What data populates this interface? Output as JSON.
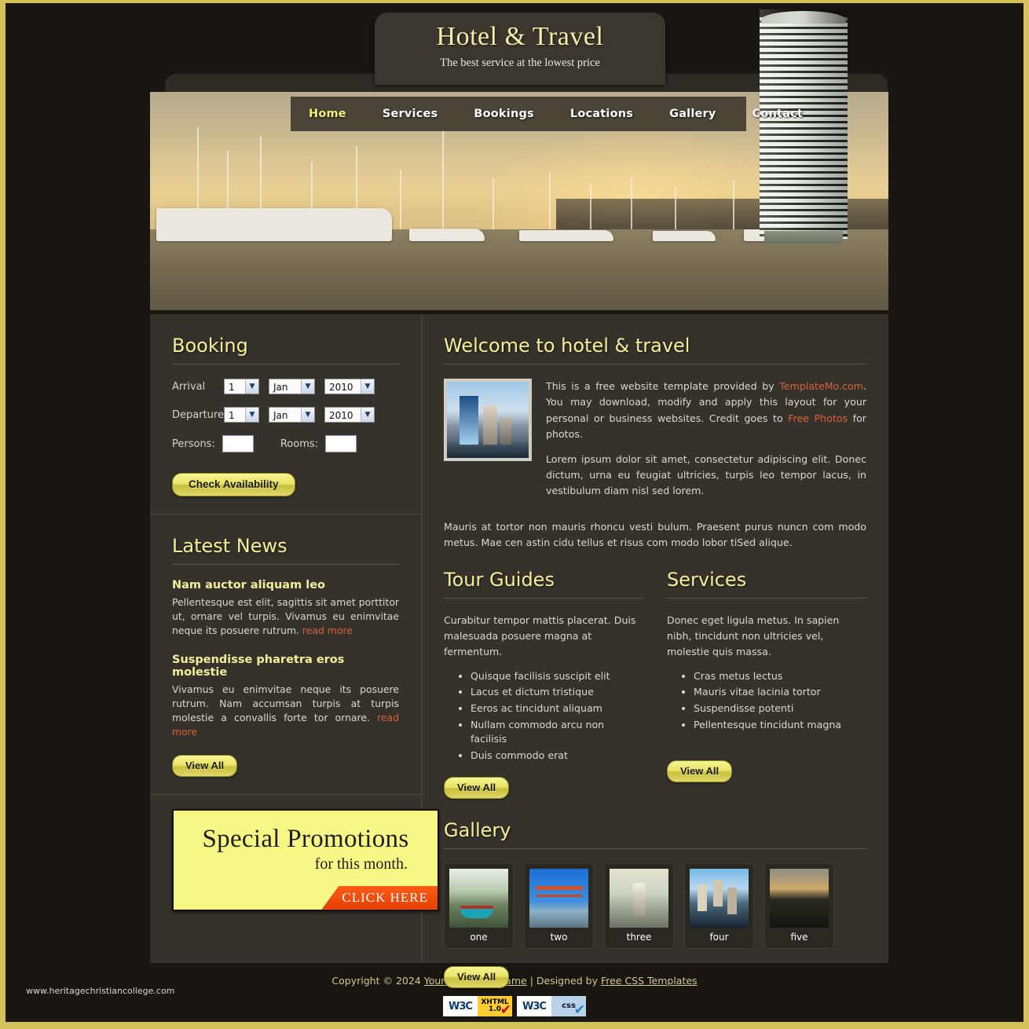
{
  "site": {
    "title": "Hotel & Travel",
    "slogan": "The best service at the lowest price"
  },
  "nav": {
    "items": [
      {
        "label": "Home",
        "active": true
      },
      {
        "label": "Services",
        "active": false
      },
      {
        "label": "Bookings",
        "active": false
      },
      {
        "label": "Locations",
        "active": false
      },
      {
        "label": "Gallery",
        "active": false
      },
      {
        "label": "Contact",
        "active": false
      }
    ]
  },
  "booking": {
    "heading": "Booking",
    "arrival_label": "Arrival",
    "departure_label": "Departure",
    "persons_label": "Persons:",
    "rooms_label": "Rooms:",
    "arrival": {
      "day": "1",
      "month": "Jan",
      "year": "2010"
    },
    "departure": {
      "day": "1",
      "month": "Jan",
      "year": "2010"
    },
    "persons_value": "",
    "rooms_value": "",
    "submit_label": "Check Availability"
  },
  "news": {
    "heading": "Latest News",
    "items": [
      {
        "title": "Nam auctor aliquam leo",
        "text": "Pellentesque est elit, sagittis sit amet porttitor ut, ornare vel turpis. Vivamus eu enimvitae neque its posuere rutrum. ",
        "readmore": "read more"
      },
      {
        "title": "Suspendisse pharetra eros molestie",
        "text": "Vivamus eu enimvitae neque its posuere rutrum. Nam accumsan turpis at turpis molestie a convallis forte tor ornare. ",
        "readmore": "read more"
      }
    ],
    "viewall_label": "View All"
  },
  "promo": {
    "line1": "Special Promotions",
    "line2": "for this month.",
    "tag": "CLICK HERE"
  },
  "welcome": {
    "heading": "Welcome to hotel & travel",
    "p1_a": "This is a free website template provided by ",
    "p1_link1": "TemplateMo.com",
    "p1_b": ". You may download, modify and apply this layout for your personal or business websites. Credit goes to ",
    "p1_link2": "Free Photos",
    "p1_c": " for photos.",
    "p2": "Lorem ipsum dolor sit amet, consectetur adipiscing elit. Donec dictum, urna eu feugiat ultricies, turpis leo tempor lacus, in vestibulum diam nisl sed lorem.",
    "p3": "Mauris at tortor non mauris rhoncu vesti bulum. Praesent purus nuncn com modo metus. Mae cen astin cidu tellus et risus com modo lobor tiSed alique."
  },
  "tour_guides": {
    "heading": "Tour Guides",
    "intro": "Curabitur tempor mattis placerat. Duis malesuada posuere magna at fermentum.",
    "items": [
      "Quisque facilisis suscipit elit",
      "Lacus et dictum tristique",
      "Eeros ac tincidunt aliquam",
      "Nullam commodo arcu non facilisis",
      "Duis commodo erat"
    ],
    "viewall_label": "View All"
  },
  "services": {
    "heading": "Services",
    "intro": "Donec eget ligula metus. In sapien nibh, tincidunt non ultricies vel, molestie quis massa.",
    "items": [
      "Cras metus lectus",
      "Mauris vitae lacinia tortor",
      "Suspendisse potenti",
      "Pellentesque tincidunt magna"
    ],
    "viewall_label": "View All"
  },
  "gallery": {
    "heading": "Gallery",
    "items": [
      {
        "caption": "one"
      },
      {
        "caption": "two"
      },
      {
        "caption": "three"
      },
      {
        "caption": "four"
      },
      {
        "caption": "five"
      }
    ],
    "viewall_label": "View All"
  },
  "footer": {
    "copyright_prefix": "Copyright © 2024 ",
    "company_link": "Your Company Name",
    "middle": " | Designed by ",
    "designer_link": "Free CSS Templates",
    "badge_xhtml_left": "W3C",
    "badge_xhtml_right": "XHTML\n1.0",
    "badge_css_left": "W3C",
    "badge_css_right": "css"
  },
  "watermark": "www.heritagechristiancollege.com",
  "colors": {
    "accent_gold": "#f4f09a",
    "frame": "#d4c157",
    "link_orange": "#d9613a",
    "panel": "#35312b",
    "page_bg": "#191511"
  }
}
